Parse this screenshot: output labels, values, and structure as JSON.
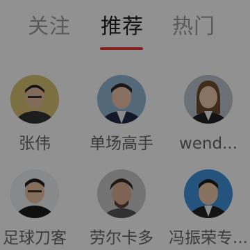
{
  "tabs": [
    {
      "label": "关注",
      "active": false
    },
    {
      "label": "推荐",
      "active": true
    },
    {
      "label": "热门",
      "active": false
    }
  ],
  "users": [
    {
      "name": "张伟",
      "avatar_icon": "person-avatar-icon"
    },
    {
      "name": "单场高手",
      "avatar_icon": "person-avatar-icon"
    },
    {
      "name": "wend...",
      "avatar_icon": "person-avatar-icon"
    },
    {
      "name": "足球刀客",
      "avatar_icon": "person-avatar-icon"
    },
    {
      "name": "劳尔卡多",
      "avatar_icon": "person-avatar-icon"
    },
    {
      "name": "冯振荣专...",
      "avatar_icon": "person-avatar-icon"
    }
  ],
  "colors": {
    "active_tab_indicator": "#e53935",
    "overlay": "rgba(0,0,0,0.42)"
  }
}
